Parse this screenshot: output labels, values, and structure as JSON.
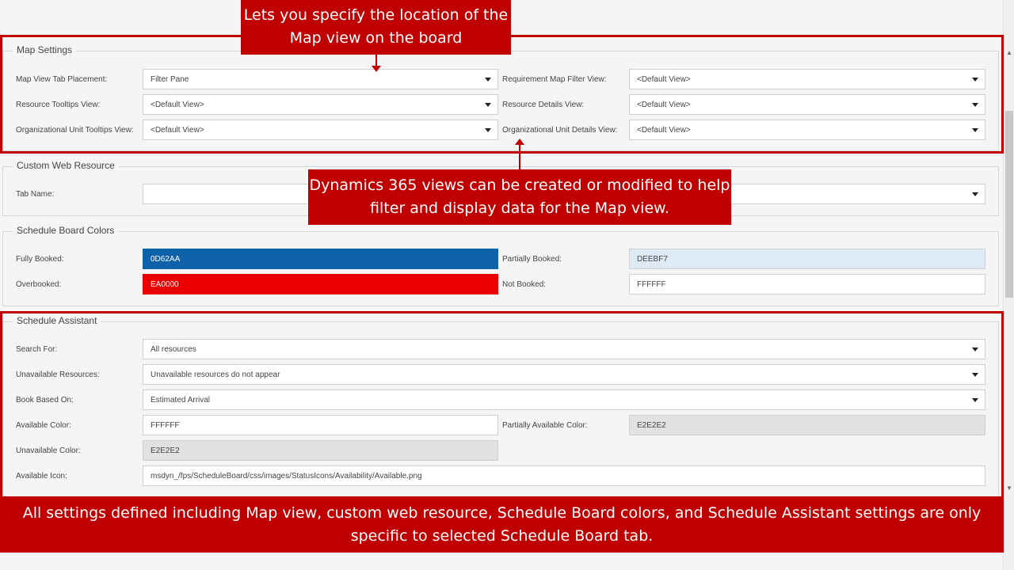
{
  "callouts": {
    "top": "Lets you specify the location of the Map view on the board",
    "middle": "Dynamics 365 views can be created or modified to help filter and display data for the Map view.",
    "bottom": "All settings defined including Map view, custom web resource, Schedule Board colors, and Schedule Assistant settings are only specific to selected Schedule Board tab."
  },
  "map_settings": {
    "title": "Map Settings",
    "map_view_tab_placement": {
      "label": "Map View Tab Placement:",
      "value": "Filter Pane"
    },
    "requirement_map_filter_view": {
      "label": "Requirement Map Filter View:",
      "value": "<Default View>"
    },
    "resource_tooltips_view": {
      "label": "Resource Tooltips View:",
      "value": "<Default View>"
    },
    "resource_details_view": {
      "label": "Resource Details View:",
      "value": "<Default View>"
    },
    "org_unit_tooltips_view": {
      "label": "Organizational Unit Tooltips View:",
      "value": "<Default View>"
    },
    "org_unit_details_view": {
      "label": "Organizational Unit Details View:",
      "value": "<Default View>"
    }
  },
  "custom_web_resource": {
    "title": "Custom Web Resource",
    "tab_name": {
      "label": "Tab Name:",
      "value": ""
    }
  },
  "schedule_board_colors": {
    "title": "Schedule Board Colors",
    "fully_booked": {
      "label": "Fully Booked:",
      "value": "0D62AA",
      "color": "#0D62AA"
    },
    "partially_booked": {
      "label": "Partially Booked:",
      "value": "DEEBF7",
      "color": "#DEEBF7"
    },
    "overbooked": {
      "label": "Overbooked:",
      "value": "EA0000",
      "color": "#EA0000"
    },
    "not_booked": {
      "label": "Not Booked:",
      "value": "FFFFFF",
      "color": "#FFFFFF"
    }
  },
  "schedule_assistant": {
    "title": "Schedule Assistant",
    "search_for": {
      "label": "Search For:",
      "value": "All resources"
    },
    "unavailable_resources": {
      "label": "Unavailable Resources:",
      "value": "Unavailable resources do not appear"
    },
    "book_based_on": {
      "label": "Book Based On:",
      "value": "Estimated Arrival"
    },
    "available_color": {
      "label": "Available Color:",
      "value": "FFFFFF"
    },
    "partially_available_color": {
      "label": "Partially Available Color:",
      "value": "E2E2E2"
    },
    "unavailable_color": {
      "label": "Unavailable Color:",
      "value": "E2E2E2"
    },
    "available_icon": {
      "label": "Available Icon:",
      "value": "msdyn_/fps/ScheduleBoard/css/images/StatusIcons/Availability/Available.png"
    }
  },
  "colors": {
    "accent_red": "#C00000",
    "disabled_field": "#E2E2E2"
  }
}
